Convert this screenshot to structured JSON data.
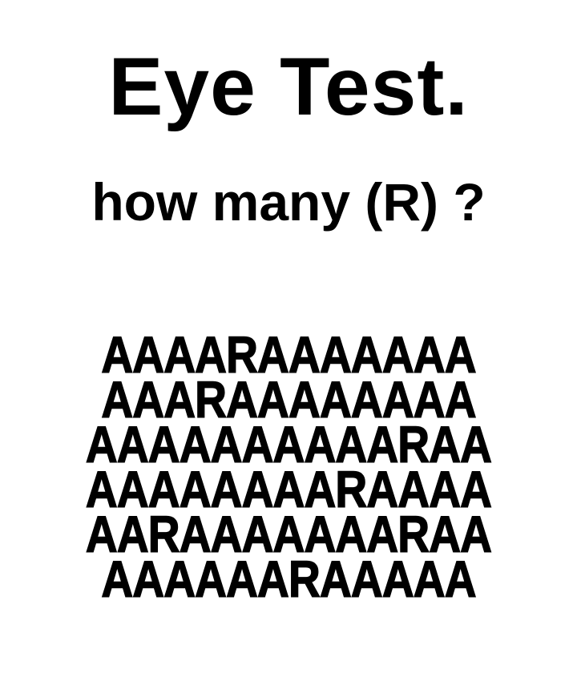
{
  "title": "Eye Test.",
  "question": "how many (R) ?",
  "letter_rows": [
    "AAAARAAAAAAA",
    "AAARAAAAAAAA",
    "AAAAAAAAAARAA",
    "AAAAAAAARAAAA",
    "AARAAAAAAARAA",
    "AAAAAARAAAAA"
  ]
}
